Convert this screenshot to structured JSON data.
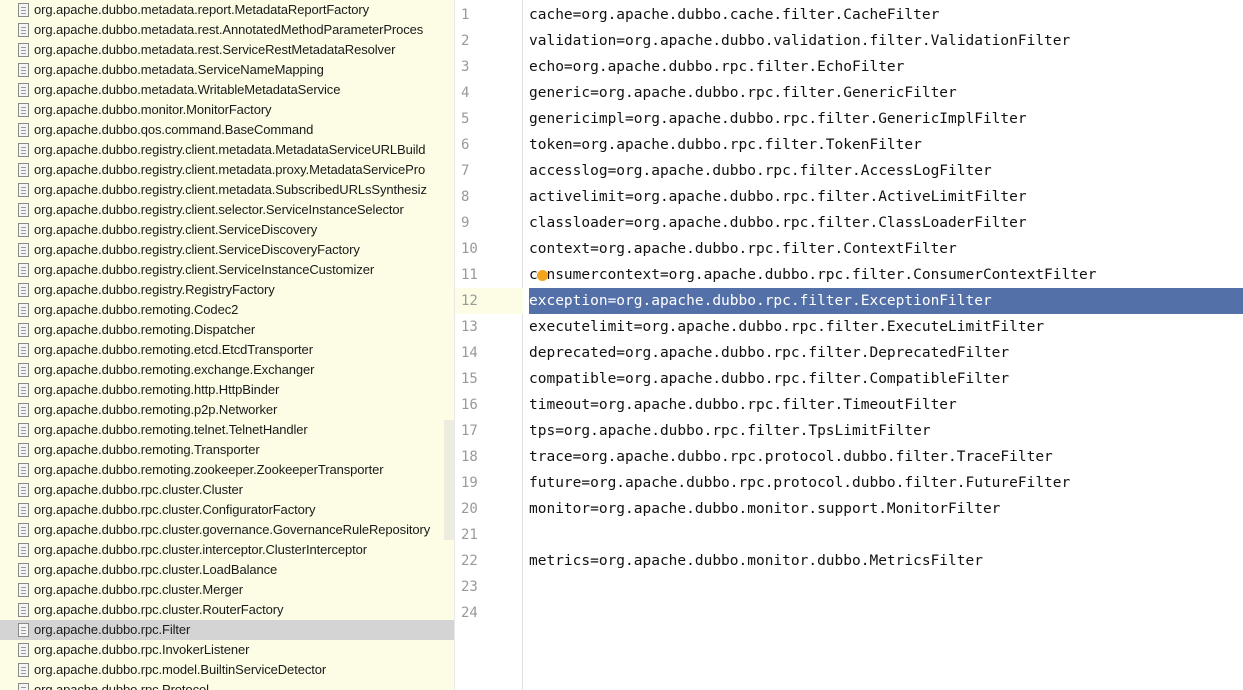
{
  "file_tree": {
    "items": [
      {
        "label": "org.apache.dubbo.metadata.report.MetadataReportFactory"
      },
      {
        "label": "org.apache.dubbo.metadata.rest.AnnotatedMethodParameterProces"
      },
      {
        "label": "org.apache.dubbo.metadata.rest.ServiceRestMetadataResolver"
      },
      {
        "label": "org.apache.dubbo.metadata.ServiceNameMapping"
      },
      {
        "label": "org.apache.dubbo.metadata.WritableMetadataService"
      },
      {
        "label": "org.apache.dubbo.monitor.MonitorFactory"
      },
      {
        "label": "org.apache.dubbo.qos.command.BaseCommand"
      },
      {
        "label": "org.apache.dubbo.registry.client.metadata.MetadataServiceURLBuild"
      },
      {
        "label": "org.apache.dubbo.registry.client.metadata.proxy.MetadataServicePro"
      },
      {
        "label": "org.apache.dubbo.registry.client.metadata.SubscribedURLsSynthesiz"
      },
      {
        "label": "org.apache.dubbo.registry.client.selector.ServiceInstanceSelector"
      },
      {
        "label": "org.apache.dubbo.registry.client.ServiceDiscovery"
      },
      {
        "label": "org.apache.dubbo.registry.client.ServiceDiscoveryFactory"
      },
      {
        "label": "org.apache.dubbo.registry.client.ServiceInstanceCustomizer"
      },
      {
        "label": "org.apache.dubbo.registry.RegistryFactory"
      },
      {
        "label": "org.apache.dubbo.remoting.Codec2"
      },
      {
        "label": "org.apache.dubbo.remoting.Dispatcher"
      },
      {
        "label": "org.apache.dubbo.remoting.etcd.EtcdTransporter"
      },
      {
        "label": "org.apache.dubbo.remoting.exchange.Exchanger"
      },
      {
        "label": "org.apache.dubbo.remoting.http.HttpBinder"
      },
      {
        "label": "org.apache.dubbo.remoting.p2p.Networker"
      },
      {
        "label": "org.apache.dubbo.remoting.telnet.TelnetHandler"
      },
      {
        "label": "org.apache.dubbo.remoting.Transporter"
      },
      {
        "label": "org.apache.dubbo.remoting.zookeeper.ZookeeperTransporter"
      },
      {
        "label": "org.apache.dubbo.rpc.cluster.Cluster"
      },
      {
        "label": "org.apache.dubbo.rpc.cluster.ConfiguratorFactory"
      },
      {
        "label": "org.apache.dubbo.rpc.cluster.governance.GovernanceRuleRepository"
      },
      {
        "label": "org.apache.dubbo.rpc.cluster.interceptor.ClusterInterceptor"
      },
      {
        "label": "org.apache.dubbo.rpc.cluster.LoadBalance"
      },
      {
        "label": "org.apache.dubbo.rpc.cluster.Merger"
      },
      {
        "label": "org.apache.dubbo.rpc.cluster.RouterFactory"
      },
      {
        "label": "org.apache.dubbo.rpc.Filter",
        "selected": true
      },
      {
        "label": "org.apache.dubbo.rpc.InvokerListener"
      },
      {
        "label": "org.apache.dubbo.rpc.model.BuiltinServiceDetector"
      },
      {
        "label": "org.apache.dubbo.rpc.Protocol"
      }
    ]
  },
  "editor": {
    "icon": "bulb-icon",
    "selection_color": "#5470a8",
    "current_line": 12,
    "lines": [
      {
        "number": "1",
        "text": "cache=org.apache.dubbo.cache.filter.CacheFilter"
      },
      {
        "number": "2",
        "text": "validation=org.apache.dubbo.validation.filter.ValidationFilter"
      },
      {
        "number": "3",
        "text": "echo=org.apache.dubbo.rpc.filter.EchoFilter"
      },
      {
        "number": "4",
        "text": "generic=org.apache.dubbo.rpc.filter.GenericFilter"
      },
      {
        "number": "5",
        "text": "genericimpl=org.apache.dubbo.rpc.filter.GenericImplFilter"
      },
      {
        "number": "6",
        "text": "token=org.apache.dubbo.rpc.filter.TokenFilter"
      },
      {
        "number": "7",
        "text": "accesslog=org.apache.dubbo.rpc.filter.AccessLogFilter"
      },
      {
        "number": "8",
        "text": "activelimit=org.apache.dubbo.rpc.filter.ActiveLimitFilter"
      },
      {
        "number": "9",
        "text": "classloader=org.apache.dubbo.rpc.filter.ClassLoaderFilter"
      },
      {
        "number": "10",
        "text": "context=org.apache.dubbo.rpc.filter.ContextFilter"
      },
      {
        "number": "11",
        "text": "consumercontext=org.apache.dubbo.rpc.filter.ConsumerContextFilter"
      },
      {
        "number": "12",
        "text": "exception=org.apache.dubbo.rpc.filter.ExceptionFilter",
        "selected": true
      },
      {
        "number": "13",
        "text": "executelimit=org.apache.dubbo.rpc.filter.ExecuteLimitFilter"
      },
      {
        "number": "14",
        "text": "deprecated=org.apache.dubbo.rpc.filter.DeprecatedFilter"
      },
      {
        "number": "15",
        "text": "compatible=org.apache.dubbo.rpc.filter.CompatibleFilter"
      },
      {
        "number": "16",
        "text": "timeout=org.apache.dubbo.rpc.filter.TimeoutFilter"
      },
      {
        "number": "17",
        "text": "tps=org.apache.dubbo.rpc.filter.TpsLimitFilter"
      },
      {
        "number": "18",
        "text": "trace=org.apache.dubbo.rpc.protocol.dubbo.filter.TraceFilter"
      },
      {
        "number": "19",
        "text": "future=org.apache.dubbo.rpc.protocol.dubbo.filter.FutureFilter"
      },
      {
        "number": "20",
        "text": "monitor=org.apache.dubbo.monitor.support.MonitorFilter"
      },
      {
        "number": "21",
        "text": ""
      },
      {
        "number": "22",
        "text": "metrics=org.apache.dubbo.monitor.dubbo.MetricsFilter"
      },
      {
        "number": "23",
        "text": ""
      },
      {
        "number": "24",
        "text": ""
      }
    ]
  }
}
